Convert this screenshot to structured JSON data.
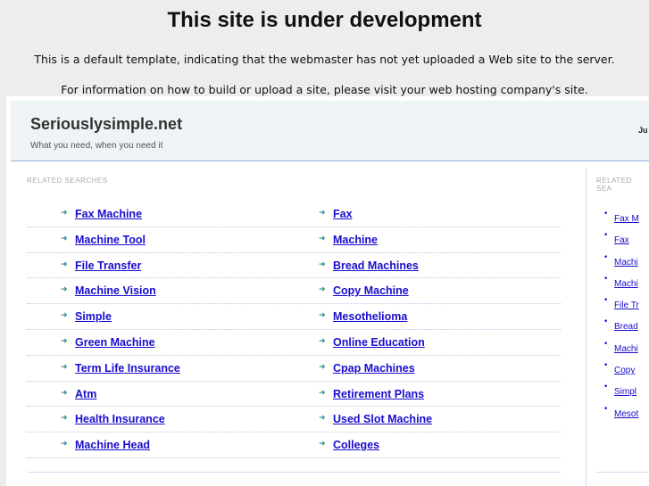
{
  "title": "This site is under development",
  "info1": "This is a default template, indicating that the webmaster has not yet uploaded a Web site to the server.",
  "info2": "For information on how to build or upload a site, please visit your web hosting company's site.",
  "brand": "Seriouslysimple.net",
  "tagline": "What you need, when you need it",
  "header_right": "Ju",
  "related_label": "RELATED SEARCHES",
  "side_label": "RELATED SEA",
  "rows": [
    [
      "Fax Machine",
      "Fax"
    ],
    [
      "Machine Tool",
      "Machine"
    ],
    [
      "File Transfer",
      "Bread Machines"
    ],
    [
      "Machine Vision",
      "Copy Machine"
    ],
    [
      "Simple",
      "Mesothelioma"
    ],
    [
      "Green Machine",
      "Online Education"
    ],
    [
      "Term Life Insurance",
      "Cpap Machines"
    ],
    [
      "Atm",
      "Retirement Plans"
    ],
    [
      "Health Insurance",
      "Used Slot Machine"
    ],
    [
      "Machine Head",
      "Colleges"
    ]
  ],
  "side": [
    "Fax M",
    "Fax",
    "Machi",
    "Machi",
    "File Tr",
    "Bread",
    "Machi",
    "Copy",
    "Simpl",
    "Mesot"
  ]
}
